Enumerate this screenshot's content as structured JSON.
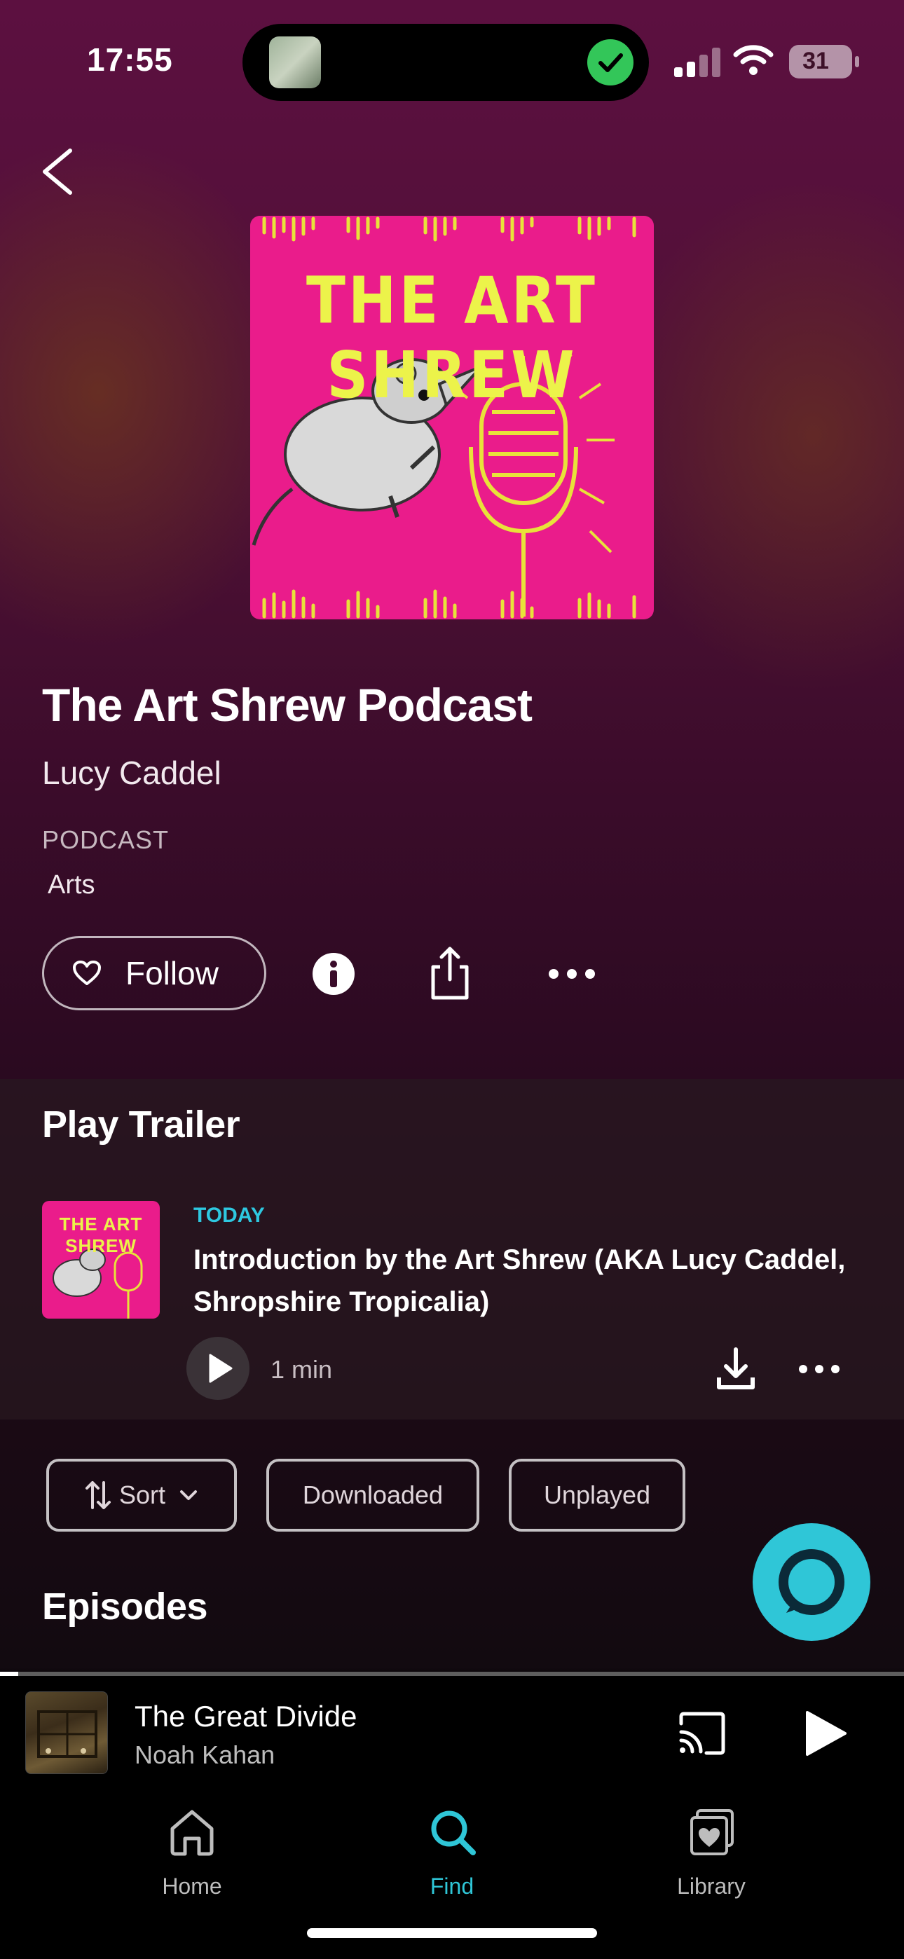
{
  "status_bar": {
    "time": "17:55",
    "battery": "31"
  },
  "podcast": {
    "cover_title": "THE ART SHREW",
    "title": "The Art Shrew Podcast",
    "author": "Lucy Caddel",
    "type_label": "PODCAST",
    "genre": "Arts"
  },
  "actions": {
    "follow_label": "Follow"
  },
  "trailer": {
    "heading": "Play Trailer",
    "thumb_title": "THE ART SHREW",
    "date": "TODAY",
    "title": "Introduction by the Art Shrew (AKA Lucy Caddel, Shropshire Tropicalia)",
    "duration": "1 min"
  },
  "filters": {
    "sort": "Sort",
    "downloaded": "Downloaded",
    "unplayed": "Unplayed"
  },
  "episodes_heading": "Episodes",
  "now_playing": {
    "title": "The Great Divide",
    "artist": "Noah Kahan",
    "progress_fraction": 0.02
  },
  "tabs": [
    {
      "label": "Home",
      "icon": "home-icon"
    },
    {
      "label": "Find",
      "icon": "search-icon",
      "active": true
    },
    {
      "label": "Library",
      "icon": "library-icon"
    }
  ],
  "colors": {
    "accent": "#2fc6d7",
    "cover_pink": "#ea1c8b",
    "cover_yellow": "#ecf34a"
  }
}
